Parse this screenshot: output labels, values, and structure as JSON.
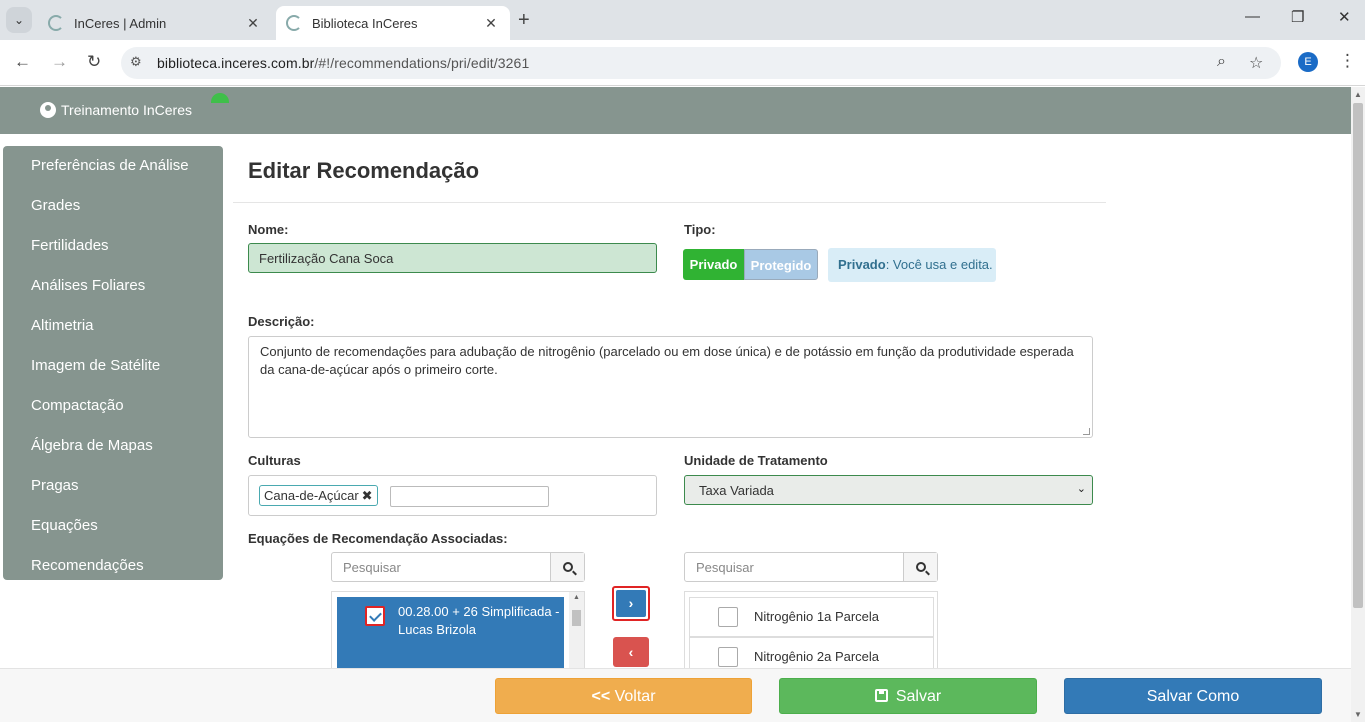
{
  "browser": {
    "tabs": [
      {
        "title": "InCeres | Admin",
        "active": false
      },
      {
        "title": "Biblioteca InCeres",
        "active": true
      }
    ],
    "url_host": "biblioteca.inceres.com.br",
    "url_path": "/#!/recommendations/pri/edit/3261",
    "profile_initial": "E"
  },
  "header": {
    "user_name": "Treinamento InCeres"
  },
  "sidebar": {
    "items": [
      {
        "label": "Preferências de Análise"
      },
      {
        "label": "Grades"
      },
      {
        "label": "Fertilidades"
      },
      {
        "label": "Análises Foliares"
      },
      {
        "label": "Altimetria"
      },
      {
        "label": "Imagem de Satélite"
      },
      {
        "label": "Compactação"
      },
      {
        "label": "Álgebra de Mapas"
      },
      {
        "label": "Pragas"
      },
      {
        "label": "Equações"
      },
      {
        "label": "Recomendações"
      }
    ]
  },
  "form": {
    "title": "Editar Recomendação",
    "nome_label": "Nome:",
    "nome_value": "Fertilização Cana Soca",
    "tipo_label": "Tipo:",
    "tipo_privado": "Privado",
    "tipo_protegido": "Protegido",
    "tipo_info_bold": "Privado",
    "tipo_info_rest": ": Você usa e edita.",
    "descricao_label": "Descrição:",
    "descricao_value": "Conjunto de recomendações para adubação de nitrogênio (parcelado ou em dose única) e de potássio em função da produtividade esperada da cana-de-açúcar após o primeiro corte.",
    "culturas_label": "Culturas",
    "cultura_tag": "Cana-de-Açúcar",
    "unidade_label": "Unidade de Tratamento",
    "unidade_value": "Taxa Variada",
    "equacoes_label": "Equações de Recomendação Associadas:",
    "search_placeholder": "Pesquisar",
    "left_items": [
      {
        "label": "00.28.00 + 26 Simplificada - Lucas Brizola",
        "checked": true
      }
    ],
    "right_items": [
      {
        "label": "Nitrogênio 1a Parcela",
        "checked": false
      },
      {
        "label": "Nitrogênio 2a Parcela",
        "checked": false
      }
    ]
  },
  "footer": {
    "voltar_label": "Voltar",
    "salvar_label": "Salvar",
    "salvar_como_label": "Salvar Como"
  },
  "colors": {
    "header": "#86958f",
    "privado": "#30b333",
    "primary": "#337ab7",
    "warning": "#f0ad4e",
    "success": "#5cb85c",
    "danger": "#d9534f"
  }
}
